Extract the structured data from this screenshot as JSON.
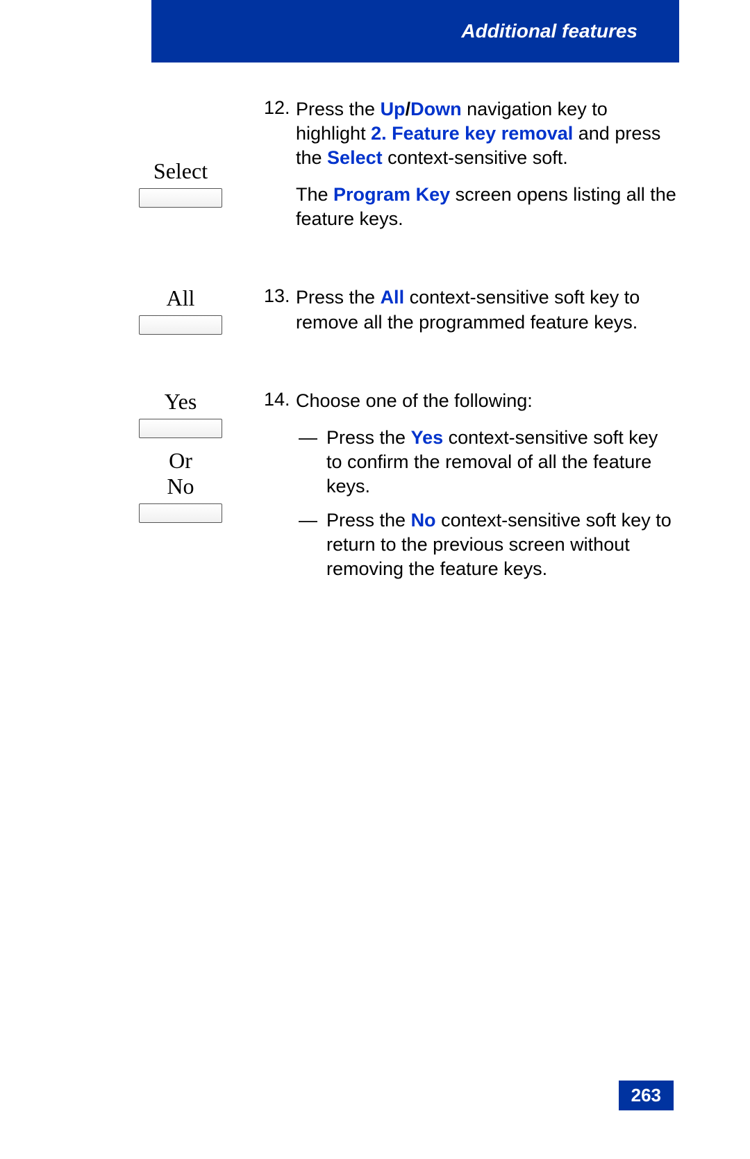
{
  "header": {
    "title": "Additional features"
  },
  "steps": {
    "s12": {
      "num": "12.",
      "label": "Select",
      "p1_a": "Press the ",
      "p1_b": "Up",
      "p1_slash": "/",
      "p1_c": "Down",
      "p1_d": " navigation key to highlight ",
      "p1_e": "2. Feature key removal",
      "p1_f": " and press the ",
      "p1_g": "Select",
      "p1_h": " context-sensitive soft.",
      "p2_a": "The ",
      "p2_b": "Program Key",
      "p2_c": " screen opens listing all the feature keys."
    },
    "s13": {
      "num": "13.",
      "label": "All",
      "p1_a": "Press the ",
      "p1_b": "All",
      "p1_c": " context-sensitive soft key to remove all the programmed feature keys."
    },
    "s14": {
      "num": "14.",
      "label_yes": "Yes",
      "label_or": "Or",
      "label_no": "No",
      "intro": "Choose one of the following:",
      "opt1_a": "Press the ",
      "opt1_b": "Yes",
      "opt1_c": " context-sensitive soft key to confirm the removal of all the feature keys.",
      "opt2_a": "Press the ",
      "opt2_b": "No",
      "opt2_c": " context-sensitive soft key to return to the previous screen without removing the feature keys."
    }
  },
  "page_number": "263",
  "dash": "—"
}
